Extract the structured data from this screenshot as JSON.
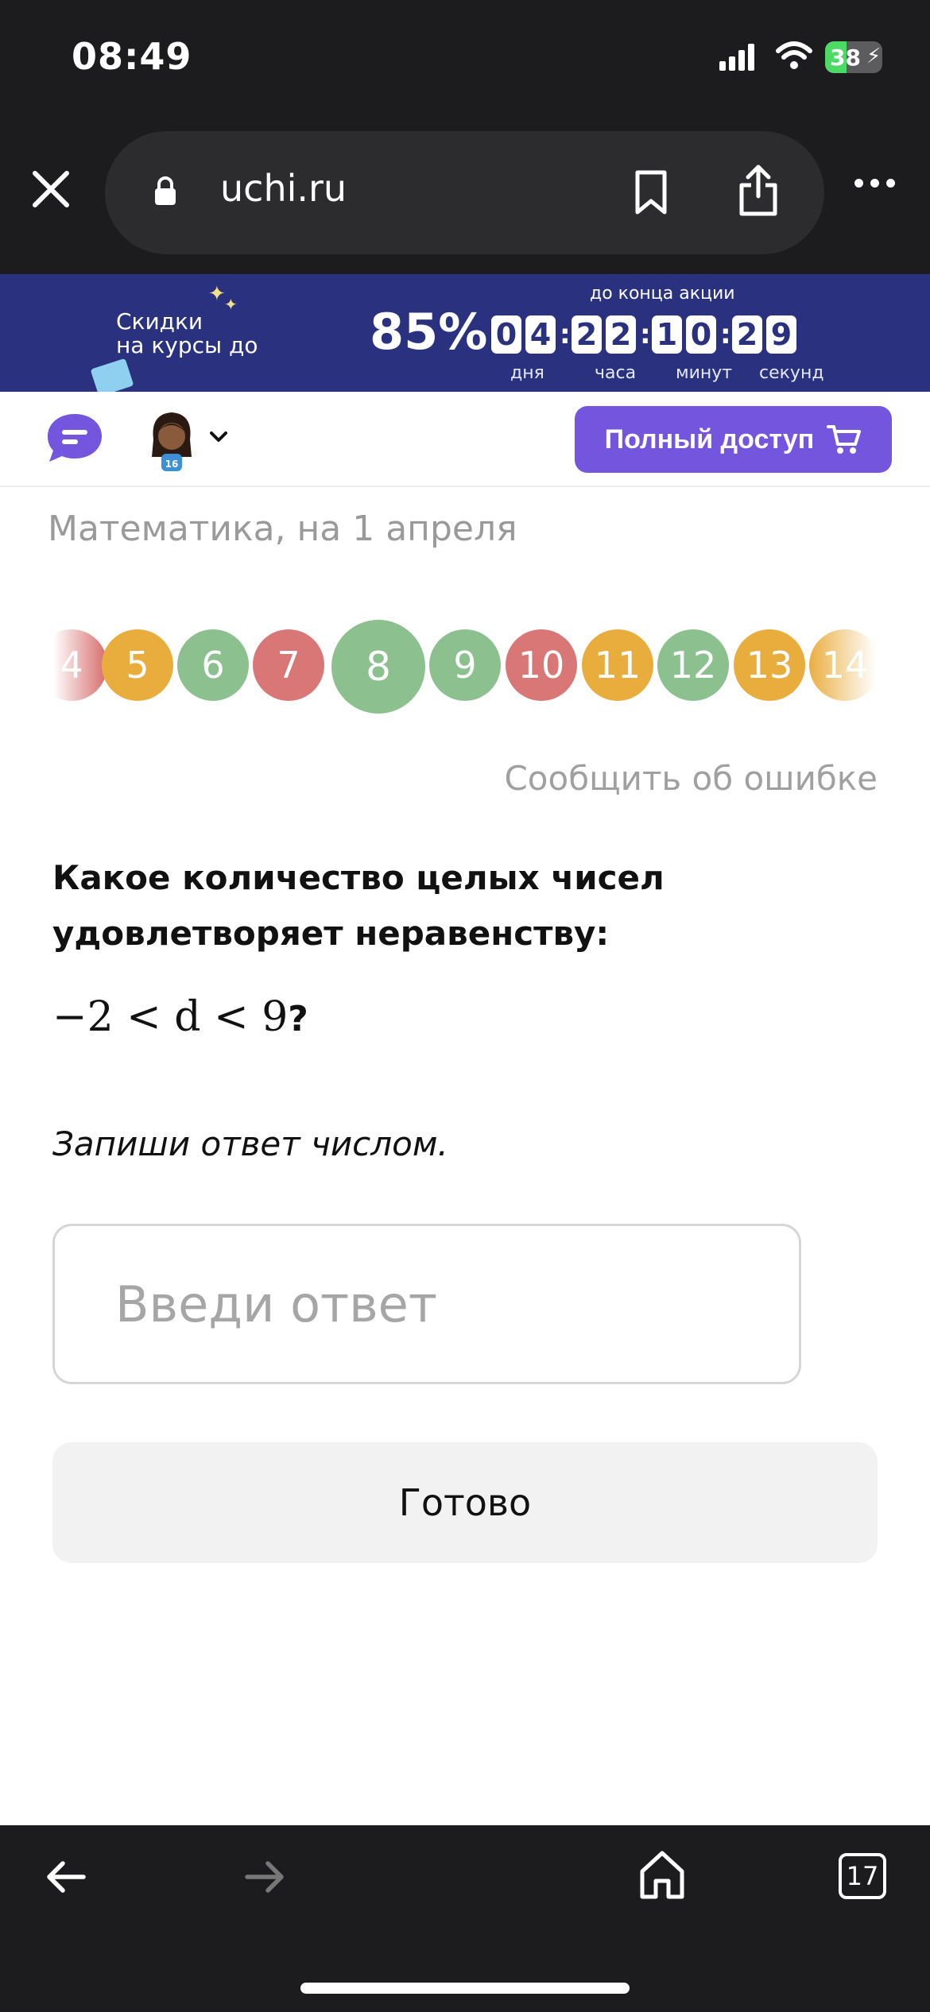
{
  "status_bar": {
    "time": "08:49",
    "battery": "38",
    "battery_level": 0.38
  },
  "browser": {
    "url": "uchi.ru"
  },
  "promo": {
    "label_line1": "Скидки",
    "label_line2": "на курсы до",
    "percent": "85%",
    "until_label": "до конца акции",
    "timer": {
      "days": [
        "0",
        "4"
      ],
      "hours": [
        "2",
        "2"
      ],
      "minutes": [
        "1",
        "0"
      ],
      "seconds": [
        "2",
        "9"
      ]
    },
    "units": {
      "days": "дня",
      "hours": "часа",
      "minutes": "минут",
      "seconds": "секунд"
    }
  },
  "header": {
    "full_access_label": "Полный доступ"
  },
  "breadcrumb": "Математика, на 1 апреля",
  "steps": [
    {
      "label": "4",
      "color": "#d97676"
    },
    {
      "label": "5",
      "color": "#e9ad3e"
    },
    {
      "label": "6",
      "color": "#8cc08f"
    },
    {
      "label": "7",
      "color": "#d97676"
    },
    {
      "label": "8",
      "color": "#8cc08f",
      "current": true
    },
    {
      "label": "9",
      "color": "#8cc08f"
    },
    {
      "label": "10",
      "color": "#d97676"
    },
    {
      "label": "11",
      "color": "#e9ad3e"
    },
    {
      "label": "12",
      "color": "#8cc08f"
    },
    {
      "label": "13",
      "color": "#e9ad3e"
    },
    {
      "label": "14",
      "color": "#e9ad3e"
    }
  ],
  "report_link": "Сообщить об ошибке",
  "question": "Какое количество целых чисел удовлетворяет неравенству:",
  "formula": {
    "expression": "−2 < d < 9",
    "suffix": "?"
  },
  "hint": "Запиши ответ числом.",
  "answer": {
    "placeholder": "Введи ответ",
    "value": ""
  },
  "done_label": "Готово",
  "bottom_bar": {
    "tabs_count": "17"
  },
  "colors": {
    "accent": "#7455dd",
    "promo_bg": "#2a3280",
    "chrome": "#1c1c1e"
  }
}
